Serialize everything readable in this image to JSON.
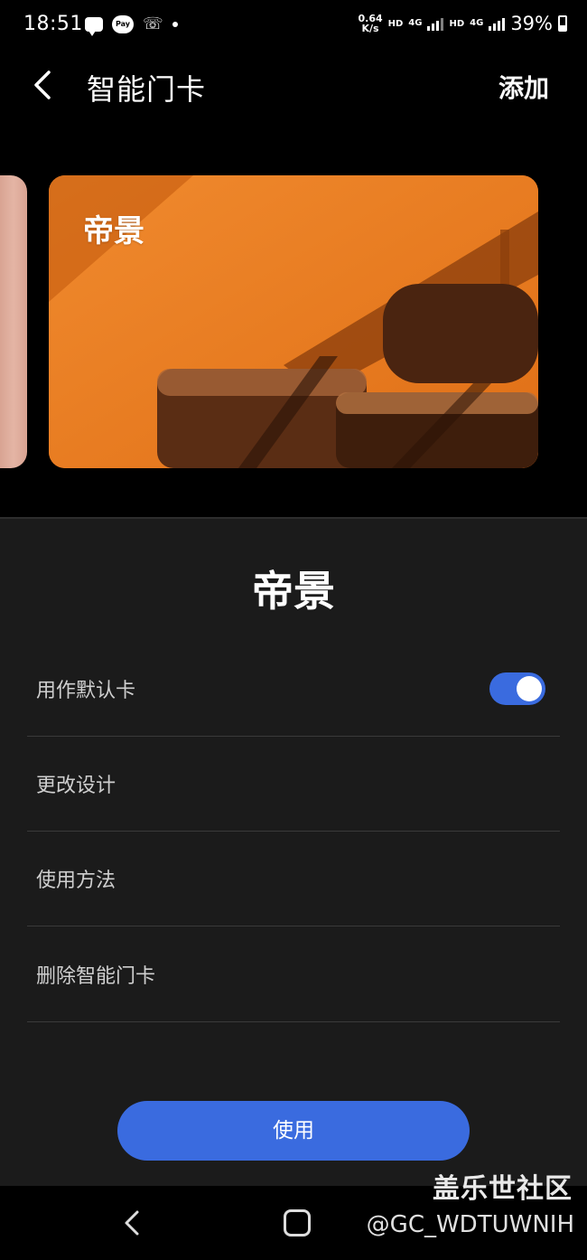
{
  "status_bar": {
    "time": "18:51",
    "pay_label": "Pay",
    "speed_top": "0.64",
    "speed_bottom": "K/s",
    "hd_1": "HD",
    "net_1": "4G",
    "hd_2": "HD",
    "net_2": "4G",
    "battery": "39%"
  },
  "app_bar": {
    "title": "智能门卡",
    "add_label": "添加"
  },
  "card": {
    "name": "帝景",
    "color": "#e7731b"
  },
  "sheet": {
    "title": "帝景",
    "rows": [
      {
        "label": "用作默认卡"
      },
      {
        "label": "更改设计"
      },
      {
        "label": "使用方法"
      },
      {
        "label": "删除智能门卡"
      }
    ],
    "default_toggle_on": true,
    "use_button": "使用"
  },
  "watermark": {
    "site": "盖乐世社区",
    "user": "@GC_WDTUWNIH"
  },
  "colors": {
    "accent": "#3a6bdf",
    "sheet_bg": "#1b1b1b",
    "divider": "#3a3a3a"
  }
}
